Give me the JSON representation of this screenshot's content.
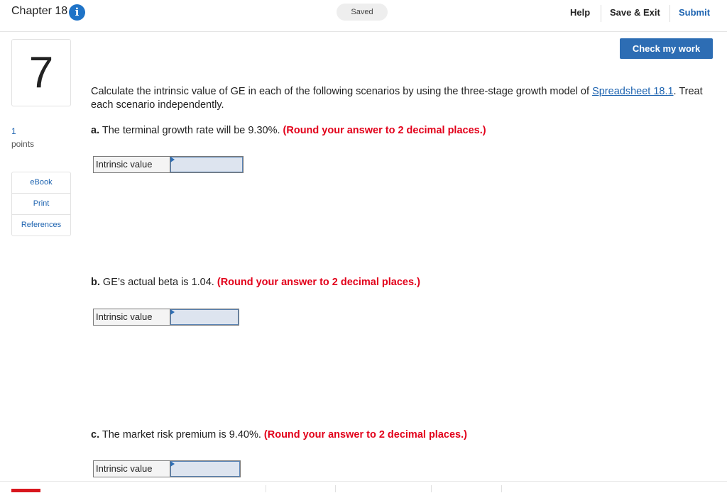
{
  "header": {
    "chapter": "Chapter 18",
    "info_icon": "i",
    "saved": "Saved",
    "help": "Help",
    "save_exit": "Save & Exit",
    "submit": "Submit"
  },
  "question": {
    "number": "7",
    "points_value": "1",
    "points_label": "points",
    "check_my_work": "Check my work",
    "prompt_prefix": "Calculate the intrinsic value of GE in each of the following scenarios by using the three-stage growth model of ",
    "prompt_link": "Spreadsheet 18.1",
    "prompt_suffix": ". Treat each scenario independently."
  },
  "side_menu": {
    "items": [
      {
        "label": "eBook"
      },
      {
        "label": "Print"
      },
      {
        "label": "References"
      }
    ]
  },
  "parts": [
    {
      "letter": "a.",
      "text": " The terminal growth rate will be 9.30%. ",
      "note": "(Round your answer to 2 decimal places.)",
      "answer_label": "Intrinsic value",
      "answer_value": ""
    },
    {
      "letter": "b.",
      "text": " GE’s actual beta is 1.04. ",
      "note": "(Round your answer to 2 decimal places.)",
      "answer_label": "Intrinsic value",
      "answer_value": ""
    },
    {
      "letter": "c.",
      "text": " The market risk premium is 9.40%. ",
      "note": "(Round your answer to 2 decimal places.)",
      "answer_label": "Intrinsic value",
      "answer_value": ""
    }
  ],
  "colors": {
    "accent": "#1d63b0",
    "button": "#2d6db4",
    "warning": "#e2001a"
  }
}
